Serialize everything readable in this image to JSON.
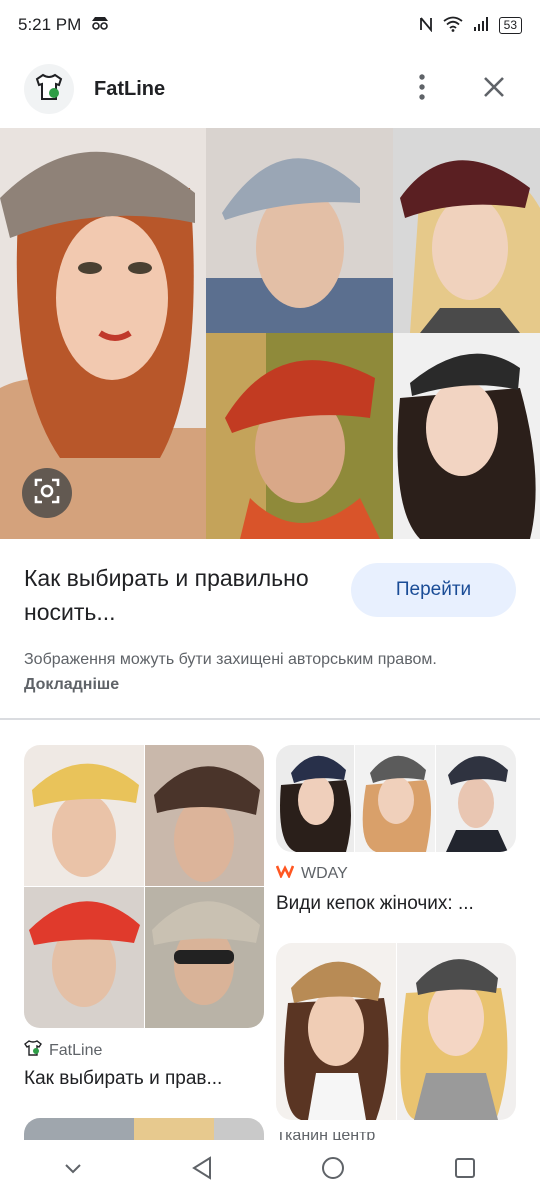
{
  "status_bar": {
    "time": "5:21 PM",
    "battery": "53"
  },
  "header": {
    "site_name": "FatLine",
    "logo_icon": "tshirt-icon",
    "more_icon": "more-vert-icon",
    "close_icon": "close-icon"
  },
  "preview": {
    "lens_icon": "lens-camera-icon"
  },
  "info": {
    "title": "Как выбирать и правильно носить...",
    "visit_label": "Перейти",
    "copyright": "Зображення можуть бути захищені авторським правом.",
    "learn_more": "Докладніше"
  },
  "results": [
    {
      "source": "FatLine",
      "title": "Как выбирать и прав..."
    },
    {
      "source": "WDAY",
      "title": "Види кепок жіночих: ..."
    },
    {
      "source": "Тканин центр",
      "title": ""
    },
    {
      "source": "",
      "title": ""
    }
  ],
  "colors": {
    "accent_button_bg": "#e8f0fe",
    "accent_button_text": "#1a4c96",
    "wday_logo": "#ff5722"
  }
}
